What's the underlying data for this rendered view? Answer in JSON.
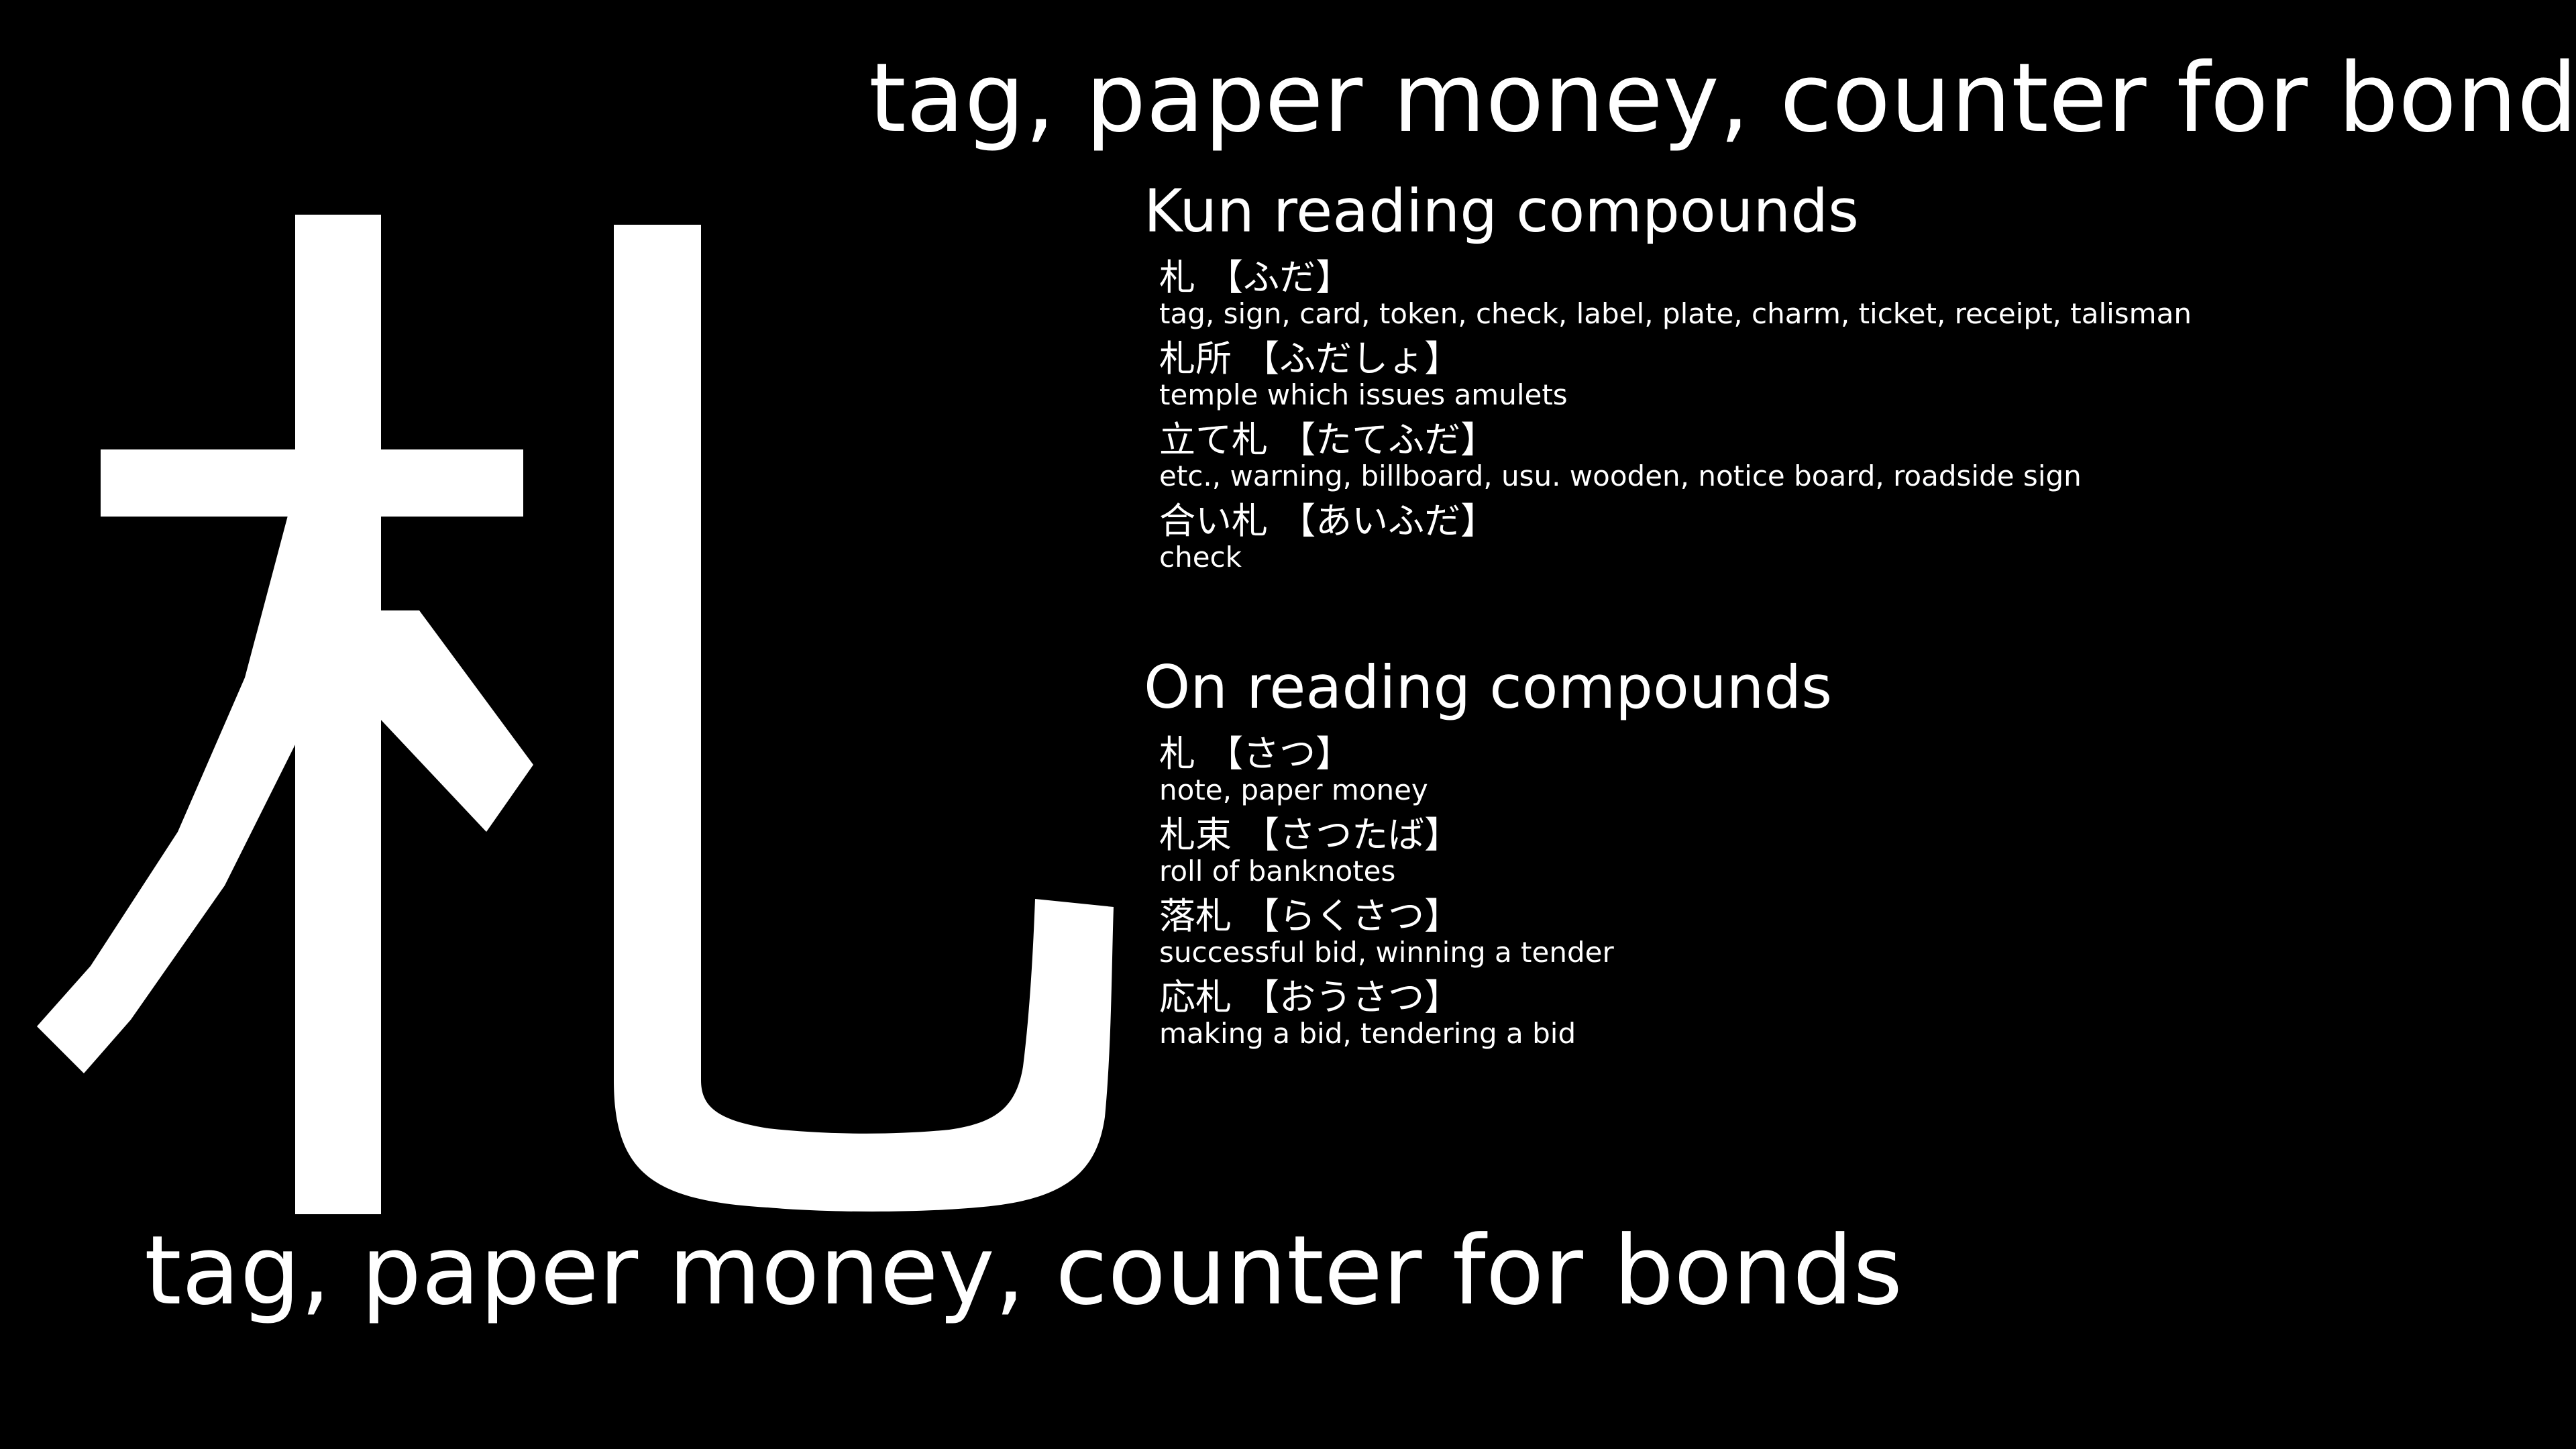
{
  "meaning": "tag, paper money, counter for bonds",
  "kanji": "札",
  "kun_section": {
    "title": "Kun reading compounds",
    "items": [
      {
        "word": "札 【ふだ】",
        "meaning": "tag, sign, card, token, check, label, plate, charm, ticket, receipt, talisman"
      },
      {
        "word": "札所 【ふだしょ】",
        "meaning": "temple which issues amulets"
      },
      {
        "word": "立て札 【たてふだ】",
        "meaning": "etc., warning, billboard, usu. wooden, notice board, roadside sign"
      },
      {
        "word": "合い札 【あいふだ】",
        "meaning": "check"
      }
    ]
  },
  "on_section": {
    "title": "On reading compounds",
    "items": [
      {
        "word": "札 【さつ】",
        "meaning": "note, paper money"
      },
      {
        "word": "札束 【さつたば】",
        "meaning": "roll of banknotes"
      },
      {
        "word": "落札 【らくさつ】",
        "meaning": "successful bid, winning a tender"
      },
      {
        "word": "応札 【おうさつ】",
        "meaning": "making a bid, tendering a bid"
      }
    ]
  },
  "colors": {
    "background": "#000000",
    "text": "#ffffff"
  }
}
